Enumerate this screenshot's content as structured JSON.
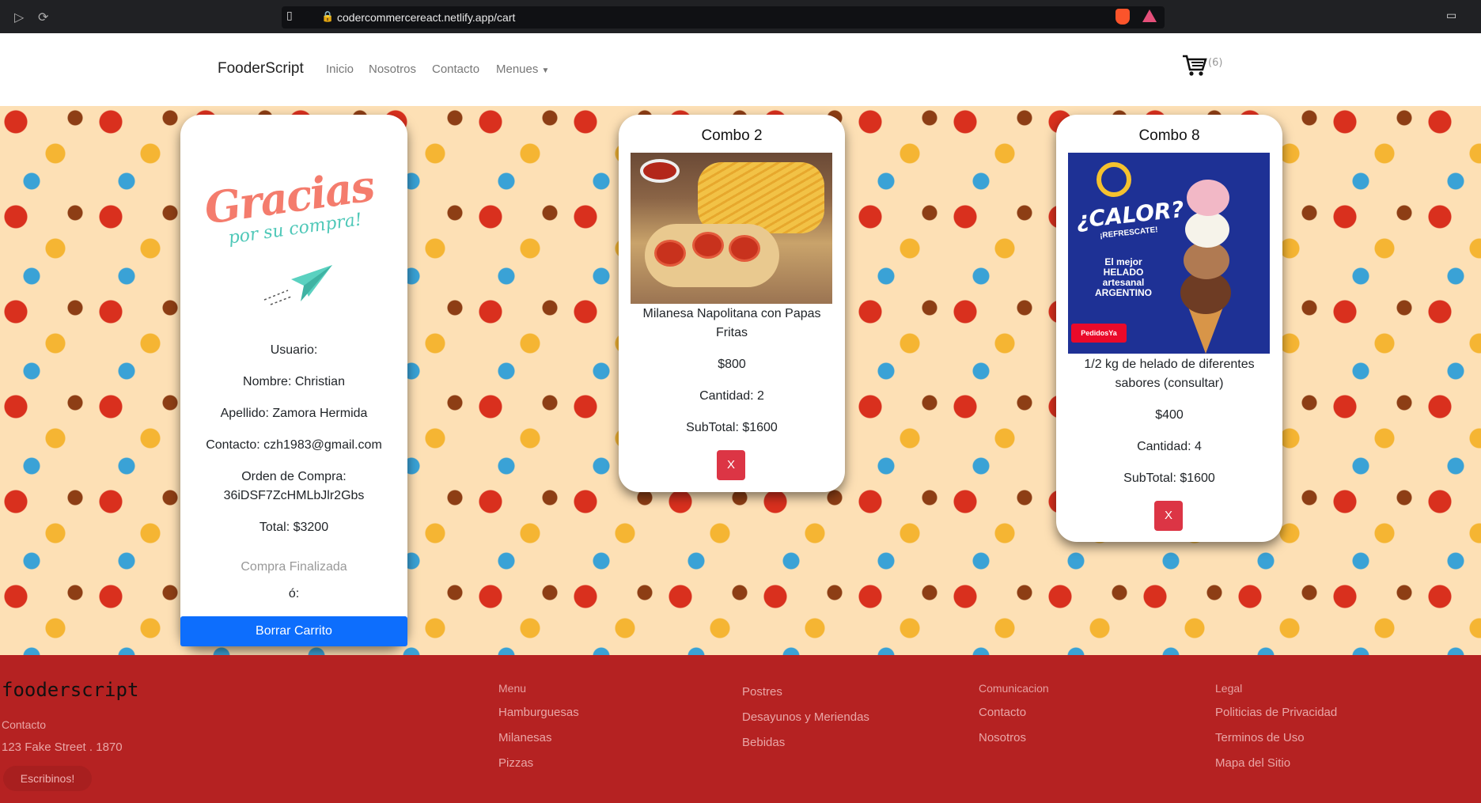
{
  "browser": {
    "url": "codercommercereact.netlify.app/cart"
  },
  "navbar": {
    "brand": "FooderScript",
    "links": [
      "Inicio",
      "Nosotros",
      "Contacto",
      "Menues"
    ],
    "cart_count": "(6)"
  },
  "thanks_card": {
    "title": "Gracias",
    "subtitle": "por su compra!",
    "usuario": "Usuario:",
    "nombre": "Nombre: Christian",
    "apellido": "Apellido: Zamora Hermida",
    "contacto": "Contacto: czh1983@gmail.com",
    "orden_label": "Orden de Compra:",
    "orden_id": "36iDSF7ZcHMLbJlr2Gbs",
    "total": "Total: $3200",
    "status": "Compra Finalizada",
    "o": "ó:",
    "clear_button": "Borrar Carrito"
  },
  "products": [
    {
      "title": "Combo 2",
      "description": "Milanesa Napolitana con Papas Fritas",
      "price": "$800",
      "quantity": "Cantidad: 2",
      "subtotal": "SubTotal: $1600",
      "remove_label": "X"
    },
    {
      "title": "Combo 8",
      "description": "1/2 kg de helado de diferentes sabores (consultar)",
      "price": "$400",
      "quantity": "Cantidad: 4",
      "subtotal": "SubTotal: $1600",
      "remove_label": "X",
      "image_text": {
        "headline": "¿CALOR?",
        "tagline": "¡REFRESCATE!",
        "body": "El mejor HELADO artesanal ARGENTINO",
        "badge": "PedidosYa"
      }
    }
  ],
  "footer": {
    "logo": "fooderscript",
    "contact_label": "Contacto",
    "address": "123 Fake Street . 1870",
    "write_button": "Escribinos!",
    "menu": {
      "heading": "Menu",
      "items": [
        "Hamburguesas",
        "Milanesas",
        "Pizzas"
      ]
    },
    "menu2": {
      "items": [
        "Postres",
        "Desayunos y Meriendas",
        "Bebidas"
      ]
    },
    "comunicacion": {
      "heading": "Comunicacion",
      "items": [
        "Contacto",
        "Nosotros"
      ]
    },
    "legal": {
      "heading": "Legal",
      "items": [
        "Politicias de Privacidad",
        "Terminos de Uso",
        "Mapa del Sitio"
      ]
    }
  },
  "colors": {
    "primary_button": "#0d6efd",
    "danger_button": "#dc3545",
    "footer_bg": "#b52222"
  }
}
